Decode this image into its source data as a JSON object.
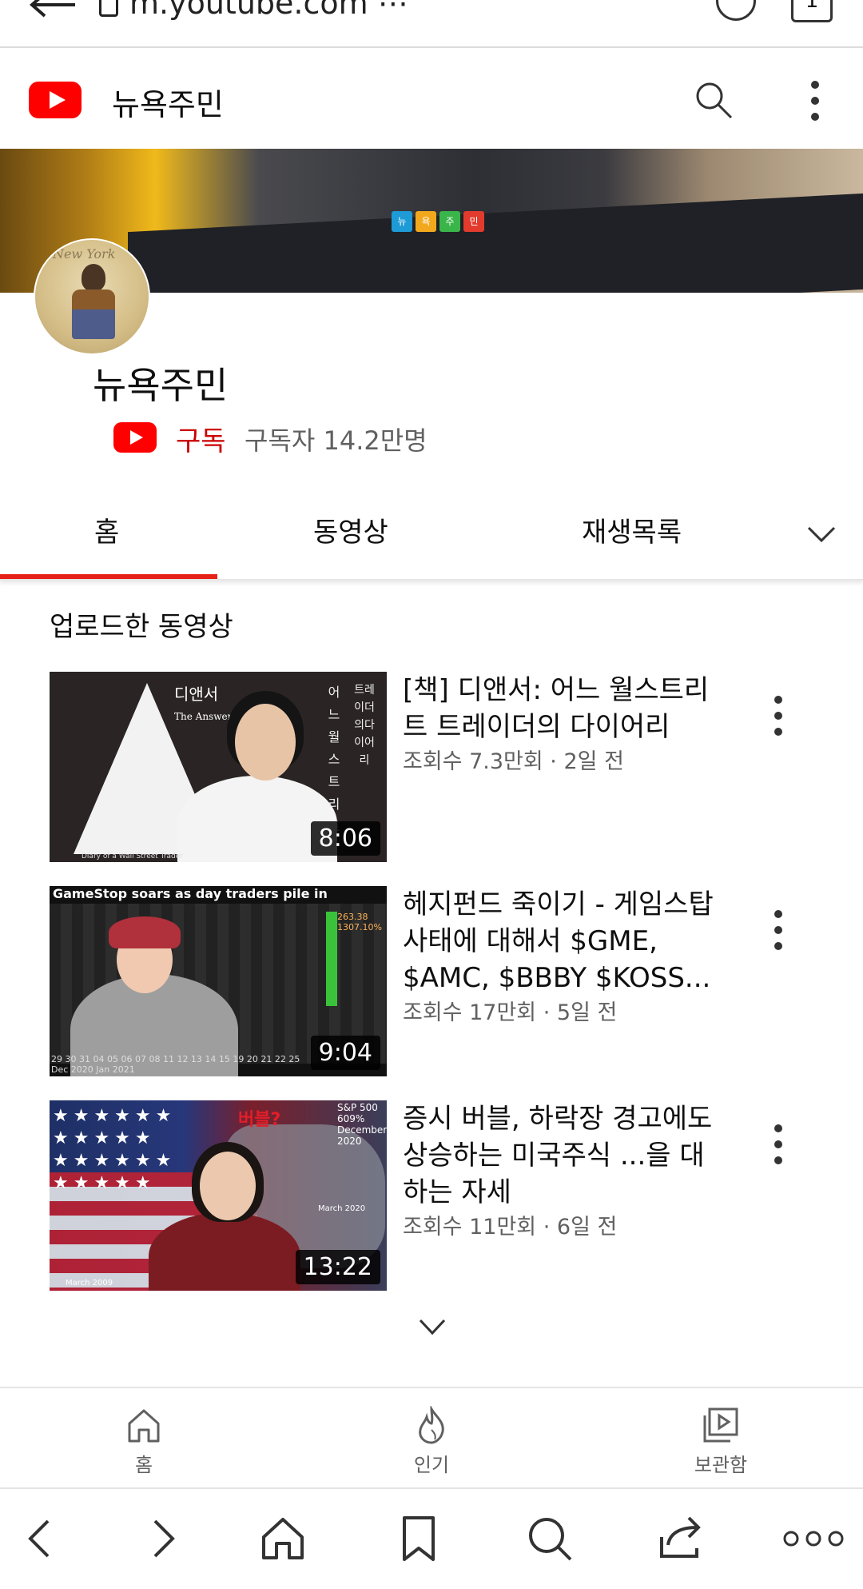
{
  "browser": {
    "url": "m.youtube.com ⋯",
    "tab_count": "1"
  },
  "header": {
    "channel_title": "뉴욕주민"
  },
  "banner": {
    "badges": [
      "뉴",
      "욕",
      "주",
      "민"
    ],
    "badge_colors": [
      "#1e9ad6",
      "#f2a81d",
      "#3ab54a",
      "#e23b2e"
    ]
  },
  "avatar": {
    "text": "New York"
  },
  "channel": {
    "name": "뉴욕주민",
    "subscribe_label": "구독",
    "subscriber_count": "구독자 14.2만명"
  },
  "tabs": [
    {
      "label": "홈",
      "active": true
    },
    {
      "label": "동영상",
      "active": false
    },
    {
      "label": "재생목록",
      "active": false
    }
  ],
  "section": {
    "title": "업로드한 동영상"
  },
  "videos": [
    {
      "title": "[책] 디앤서: 어느 월스트리트 트레이더의 다이어리",
      "meta": "조회수 7.3만회 · 2일 전",
      "duration": "8:06",
      "thumb": {
        "title": "디앤서",
        "subtitle": "The Answer",
        "col_left": "어느월스트리트",
        "col_right": "트레이더의다이어리",
        "footer": "Diary of a Wall Street Trader"
      }
    },
    {
      "title": "헤지펀드 죽이기 - 게임스탑 사태에 대해서 $GME, $AMC, $BBBY $KOSS...",
      "meta": "조회수 17만회 · 5일 전",
      "duration": "9:04",
      "thumb": {
        "headline": "GameStop soars as day traders pile in",
        "axis": "29 30 31 04 05 06 07 08 11 12 13 14 15 19 20 21 22 25",
        "axis_months": "Dec 2020          Jan 2021",
        "rate": "263.38 1307.10%"
      }
    },
    {
      "title": "증시 버블, 하락장 경고에도 상승하는 미국주식 ...을 대하는 자세",
      "meta": "조회수 11만회 · 6일 전",
      "duration": "13:22",
      "thumb": {
        "bubble": "버블?",
        "sp": "S&P 500 609% December 2020",
        "march2020": "March 2020",
        "march2009": "March 2009"
      }
    }
  ],
  "yt_nav": [
    {
      "label": "홈",
      "icon": "home-icon"
    },
    {
      "label": "인기",
      "icon": "flame-icon"
    },
    {
      "label": "보관함",
      "icon": "library-icon"
    }
  ],
  "browser_toolbar": [
    "back-icon",
    "forward-icon",
    "home-icon",
    "bookmark-icon",
    "search-icon",
    "share-icon",
    "more-icon"
  ],
  "colors": {
    "accent_red": "#ff0000",
    "subscribe_red": "#cc0000",
    "tab_underline": "#e62117",
    "meta_gray": "#606060"
  }
}
